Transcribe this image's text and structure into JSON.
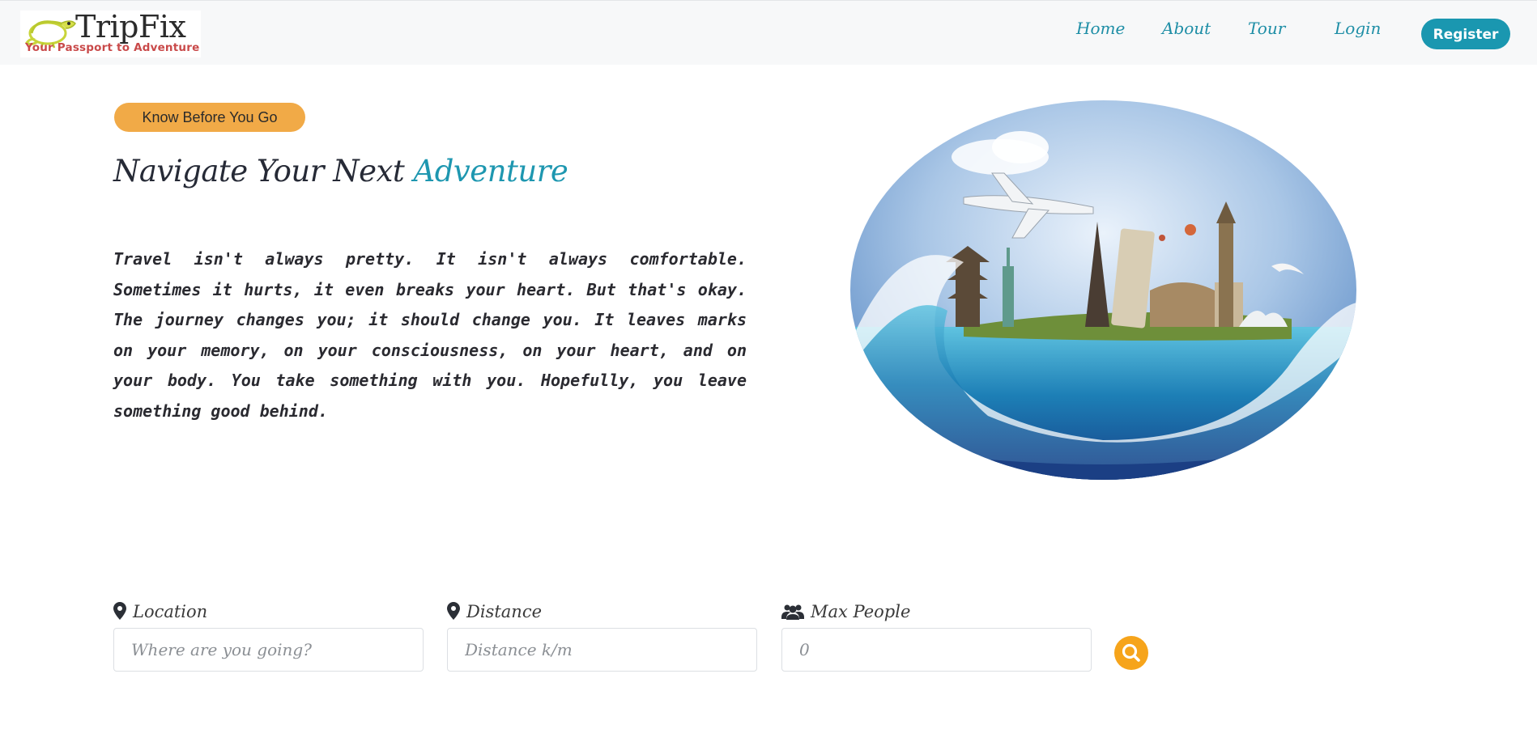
{
  "brand": {
    "name": "TripFix",
    "tagline": "Your Passport to Adventure"
  },
  "nav": {
    "links": [
      "Home",
      "About",
      "Tour",
      "Login"
    ],
    "register_label": "Register"
  },
  "hero": {
    "badge": "Know Before You Go",
    "title_main": "Navigate Your Next ",
    "title_accent": "Adventure",
    "body": "Travel isn't always pretty. It isn't always comfortable. Sometimes it hurts, it even breaks your heart. But that's okay. The journey changes you; it should change you. It leaves marks on your memory, on your consciousness, on your heart, and on your body. You take something with you. Hopefully, you leave something good behind."
  },
  "search": {
    "location": {
      "label": "Location",
      "placeholder": "Where are you going?"
    },
    "distance": {
      "label": "Distance",
      "placeholder": "Distance k/m"
    },
    "max_people": {
      "label": "Max People",
      "placeholder": "0"
    }
  },
  "colors": {
    "accent": "#1e97b0",
    "badge": "#f1aa47",
    "search_button": "#f6a41b",
    "tagline": "#c94a4a"
  }
}
